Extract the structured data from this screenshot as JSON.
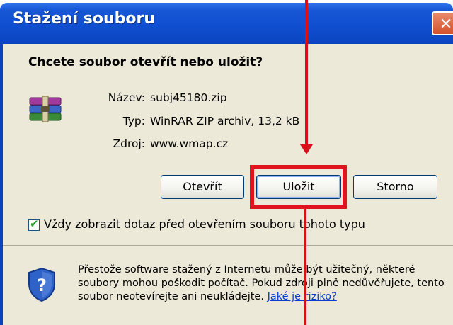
{
  "dialog": {
    "title": "Stažení souboru",
    "close_symbol": "✕",
    "question": "Chcete soubor otevřít nebo uložit?",
    "file_icon": "winrar-archive-icon",
    "fields": [
      {
        "label": "Název:",
        "value": "subj45180.zip"
      },
      {
        "label": "Typ:",
        "value": "WinRAR ZIP archiv, 13,2 kB"
      },
      {
        "label": "Zdroj:",
        "value": "www.wmap.cz"
      }
    ],
    "buttons": {
      "open": "Otevřít",
      "save": "Uložit",
      "cancel": "Storno"
    },
    "always_ask": {
      "checked": true,
      "label": "Vždy zobrazit dotaz před otevřením souboru tohoto typu"
    },
    "warning": {
      "icon": "shield-question-icon",
      "text": "Přestože software stažený z Internetu může být užitečný, některé soubory mohou poškodit počítač. Pokud zdroji plně nedůvěřujete, tento soubor neotevírejte ani neukládejte.",
      "link": "Jaké je riziko?"
    }
  },
  "annotation": {
    "color": "#e0141e",
    "highlight_target": "save-button"
  },
  "colors": {
    "titlebar": "#0f4fd0",
    "dialog_bg": "#ece9d8",
    "link": "#0a3bd4"
  }
}
